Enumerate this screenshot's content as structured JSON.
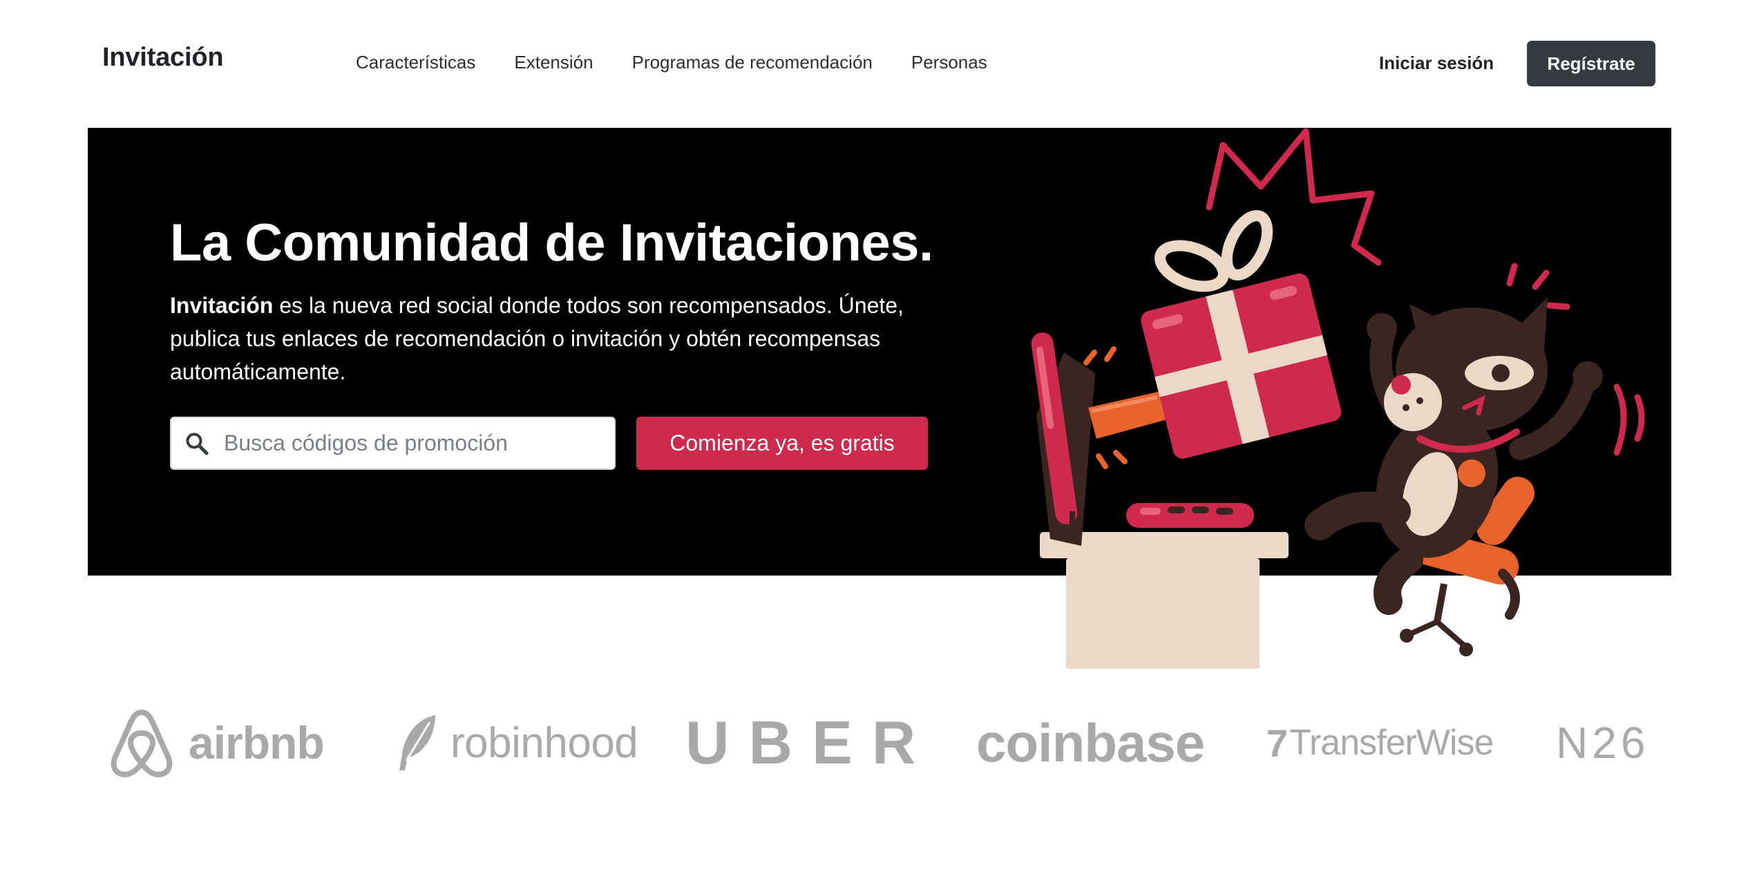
{
  "header": {
    "brand": "Invitación",
    "nav": [
      {
        "label": "Características"
      },
      {
        "label": "Extensión"
      },
      {
        "label": "Programas de recomendación"
      },
      {
        "label": "Personas"
      }
    ],
    "login_label": "Iniciar sesión",
    "signup_label": "Regístrate"
  },
  "hero": {
    "title": "La Comunidad de Invitaciones.",
    "description_bold": "Invitación",
    "description_rest": " es la nueva red social donde todos son recompensados. Únete, publica tus enlaces de recomendación o invitación y obtén recompensas automáticamente.",
    "search_placeholder": "Busca códigos de promoción",
    "cta_label": "Comienza ya, es gratis"
  },
  "logos": [
    {
      "name": "airbnb",
      "text": "airbnb"
    },
    {
      "name": "robinhood",
      "text": "robinhood"
    },
    {
      "name": "uber",
      "text": "UBER"
    },
    {
      "name": "coinbase",
      "text": "coinbase"
    },
    {
      "name": "transferwise",
      "mark": "7",
      "text": "TransferWise"
    },
    {
      "name": "n26",
      "text": "N26"
    }
  ],
  "colors": {
    "accent": "#cf2a4d",
    "signup_bg": "#343a40",
    "hero_bg": "#000000",
    "logo_gray": "#a9a9a9"
  }
}
